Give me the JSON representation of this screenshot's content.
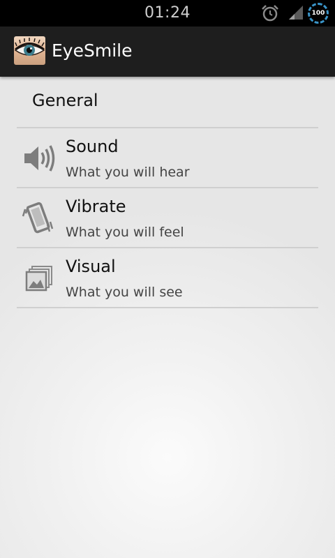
{
  "status_bar": {
    "time": "01:24",
    "battery_level": "100",
    "icons": [
      "alarm-icon",
      "signal-icon",
      "battery-icon"
    ]
  },
  "action_bar": {
    "title": "EyeSmile",
    "icon": "eye-app-icon"
  },
  "preferences": {
    "category": "General",
    "items": [
      {
        "title": "Sound",
        "summary": "What you will hear",
        "icon": "speaker-icon"
      },
      {
        "title": "Vibrate",
        "summary": "What you will feel",
        "icon": "vibrate-phone-icon"
      },
      {
        "title": "Visual",
        "summary": "What you will see",
        "icon": "image-stack-icon"
      }
    ]
  },
  "colors": {
    "action_bar": "#1e1e1e",
    "status_bar": "#000000",
    "battery_accent": "#3a95c9",
    "icon_gray": "#777777"
  }
}
